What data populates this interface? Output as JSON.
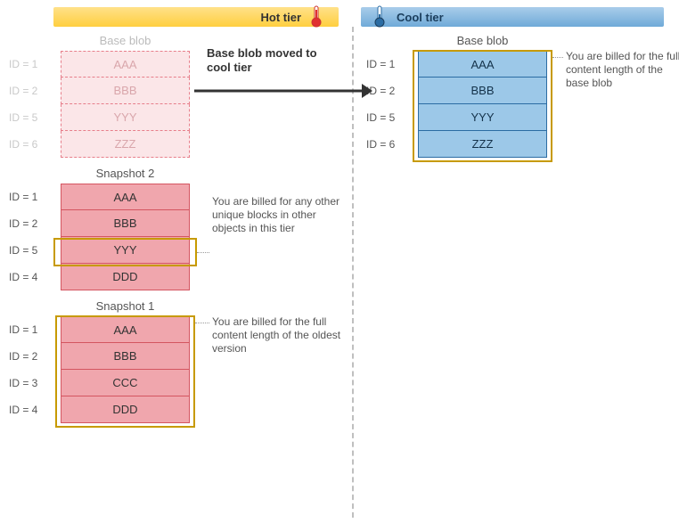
{
  "tiers": {
    "hot_label": "Hot tier",
    "cool_label": "Cool tier"
  },
  "move_label": "Base blob moved to cool tier",
  "hot": {
    "base": {
      "title": "Base blob",
      "rows": [
        {
          "id": "ID = 1",
          "val": "AAA"
        },
        {
          "id": "ID = 2",
          "val": "BBB"
        },
        {
          "id": "ID = 5",
          "val": "YYY"
        },
        {
          "id": "ID = 6",
          "val": "ZZZ"
        }
      ]
    },
    "snap2": {
      "title": "Snapshot 2",
      "rows": [
        {
          "id": "ID = 1",
          "val": "AAA"
        },
        {
          "id": "ID = 2",
          "val": "BBB"
        },
        {
          "id": "ID = 5",
          "val": "YYY"
        },
        {
          "id": "ID = 4",
          "val": "DDD"
        }
      ],
      "annotation": "You are billed for any other unique blocks in other objects in this tier"
    },
    "snap1": {
      "title": "Snapshot 1",
      "rows": [
        {
          "id": "ID = 1",
          "val": "AAA"
        },
        {
          "id": "ID = 2",
          "val": "BBB"
        },
        {
          "id": "ID = 3",
          "val": "CCC"
        },
        {
          "id": "ID = 4",
          "val": "DDD"
        }
      ],
      "annotation": "You are billed for the full content length of the oldest version"
    }
  },
  "cool": {
    "base": {
      "title": "Base blob",
      "rows": [
        {
          "id": "ID = 1",
          "val": "AAA"
        },
        {
          "id": "ID = 2",
          "val": "BBB"
        },
        {
          "id": "ID = 5",
          "val": "YYY"
        },
        {
          "id": "ID = 6",
          "val": "ZZZ"
        }
      ],
      "annotation": "You are billed for the full content length of the base blob"
    }
  }
}
